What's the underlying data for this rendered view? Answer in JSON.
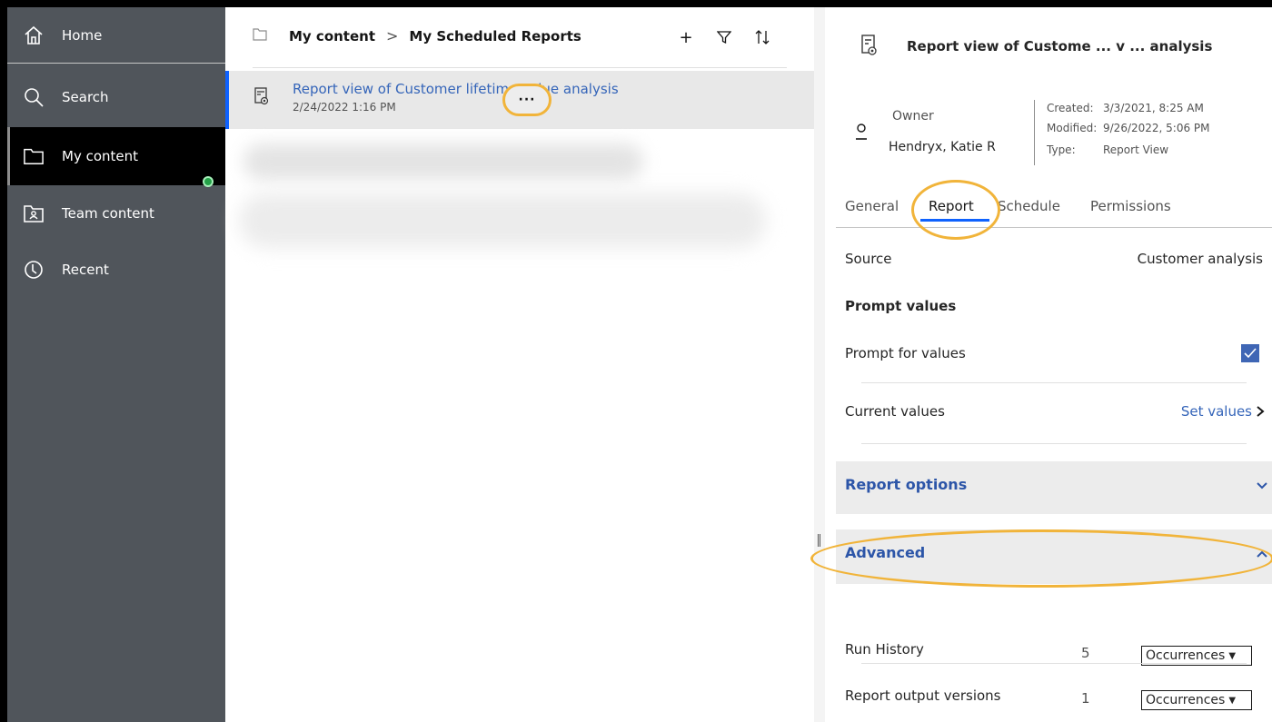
{
  "nav": {
    "items": [
      {
        "label": "Home",
        "icon": "home-icon"
      },
      {
        "label": "Search",
        "icon": "search-icon"
      },
      {
        "label": "My content",
        "icon": "folder-icon"
      },
      {
        "label": "Team content",
        "icon": "team-folder-icon"
      },
      {
        "label": "Recent",
        "icon": "clock-icon"
      }
    ]
  },
  "list": {
    "breadcrumb": [
      "My content",
      "My Scheduled Reports"
    ],
    "breadcrumb_separator": ">",
    "toolbar": {
      "add": "+",
      "filter": "filter-icon",
      "sort": "sort-icon"
    },
    "row": {
      "title": "Report view of Customer lifetime value analysis",
      "date": "2/24/2022 1:16 PM",
      "more_label": "···"
    }
  },
  "panel": {
    "title": "Report view of Custome ... v ... analysis",
    "owner_label": "Owner",
    "owner_value": "Hendryx, Katie R",
    "meta": {
      "created_label": "Created:",
      "created_value": "3/3/2021, 8:25 AM",
      "modified_label": "Modified:",
      "modified_value": "9/26/2022, 5:06 PM",
      "type_label": "Type:",
      "type_value": "Report View"
    },
    "tabs": [
      "General",
      "Report",
      "Schedule",
      "Permissions"
    ],
    "active_tab": "Report",
    "source_label": "Source",
    "source_value": "Customer analysis",
    "prompt_values_heading": "Prompt values",
    "prompt_for_values_label": "Prompt for values",
    "prompt_for_values_checked": true,
    "current_values_label": "Current values",
    "set_values_link": "Set values",
    "report_options_title": "Report options",
    "advanced_title": "Advanced",
    "run_history_label": "Run History",
    "run_history_value": "5",
    "run_history_unit": "Occurrences",
    "output_versions_label": "Report output versions",
    "output_versions_value": "1",
    "output_versions_unit": "Occurrences"
  },
  "colors": {
    "nav_bg": "#50555b",
    "link": "#3565b9",
    "highlight_ring": "#f1b43a",
    "accent": "#0f62fe",
    "status_dot": "#24a148"
  }
}
